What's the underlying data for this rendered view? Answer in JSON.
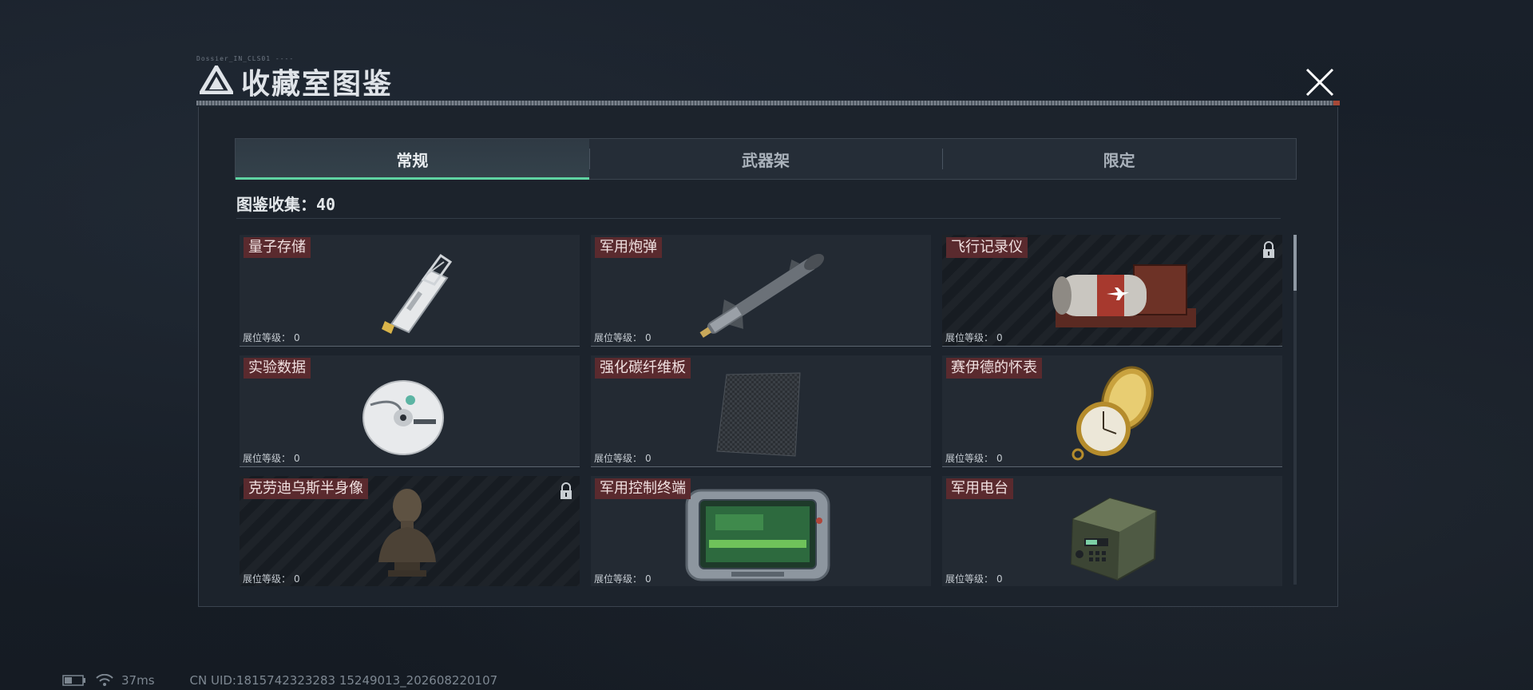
{
  "header": {
    "tiny_label": "Dossier_IN_CLS01 ----",
    "title": "收藏室图鉴",
    "close_icon": "close-icon"
  },
  "tabs": [
    {
      "label": "常规",
      "active": true
    },
    {
      "label": "武器架",
      "active": false
    },
    {
      "label": "限定",
      "active": false
    }
  ],
  "collection": {
    "label": "图鉴收集：",
    "count": "40"
  },
  "level_label": "展位等级：",
  "items": [
    {
      "name": "量子存储",
      "level": "0",
      "locked": false,
      "icon": "usb-drive-icon"
    },
    {
      "name": "军用炮弹",
      "level": "0",
      "locked": false,
      "icon": "missile-icon"
    },
    {
      "name": "飞行记录仪",
      "level": "0",
      "locked": true,
      "icon": "flight-recorder-icon"
    },
    {
      "name": "实验数据",
      "level": "0",
      "locked": false,
      "icon": "disc-icon"
    },
    {
      "name": "强化碳纤维板",
      "level": "0",
      "locked": false,
      "icon": "carbon-plate-icon"
    },
    {
      "name": "赛伊德的怀表",
      "level": "0",
      "locked": false,
      "icon": "pocket-watch-icon"
    },
    {
      "name": "克劳迪乌斯半身像",
      "level": "0",
      "locked": true,
      "icon": "bust-icon"
    },
    {
      "name": "军用控制终端",
      "level": "0",
      "locked": false,
      "icon": "control-terminal-icon"
    },
    {
      "name": "军用电台",
      "level": "0",
      "locked": false,
      "icon": "radio-icon"
    }
  ],
  "status_bar": {
    "ping": "37ms",
    "uid": "CN UID:1815742323283 15249013_202608220107"
  },
  "colors": {
    "accent": "#5fd3a2",
    "name_tag": "#5a2a2e",
    "panel": "#1c232c"
  }
}
